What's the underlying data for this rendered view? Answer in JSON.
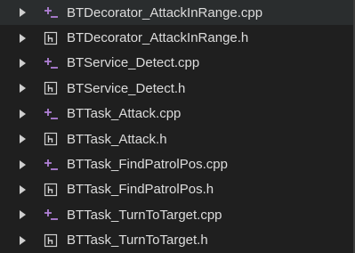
{
  "explorer": {
    "items": [
      {
        "label": "BTDecorator_AttackInRange.cpp",
        "type": "cpp",
        "icon": "cpp-file-icon"
      },
      {
        "label": "BTDecorator_AttackInRange.h",
        "type": "h",
        "icon": "header-file-icon"
      },
      {
        "label": "BTService_Detect.cpp",
        "type": "cpp",
        "icon": "cpp-file-icon"
      },
      {
        "label": "BTService_Detect.h",
        "type": "h",
        "icon": "header-file-icon"
      },
      {
        "label": "BTTask_Attack.cpp",
        "type": "cpp",
        "icon": "cpp-file-icon"
      },
      {
        "label": "BTTask_Attack.h",
        "type": "h",
        "icon": "header-file-icon"
      },
      {
        "label": "BTTask_FindPatrolPos.cpp",
        "type": "cpp",
        "icon": "cpp-file-icon"
      },
      {
        "label": "BTTask_FindPatrolPos.h",
        "type": "h",
        "icon": "header-file-icon"
      },
      {
        "label": "BTTask_TurnToTarget.cpp",
        "type": "cpp",
        "icon": "cpp-file-icon"
      },
      {
        "label": "BTTask_TurnToTarget.h",
        "type": "h",
        "icon": "header-file-icon"
      }
    ]
  },
  "colors": {
    "background": "#1f1f1f",
    "text": "#dcdcdc",
    "cpp_icon": "#b180d7",
    "header_icon": "#d0d0d0"
  }
}
